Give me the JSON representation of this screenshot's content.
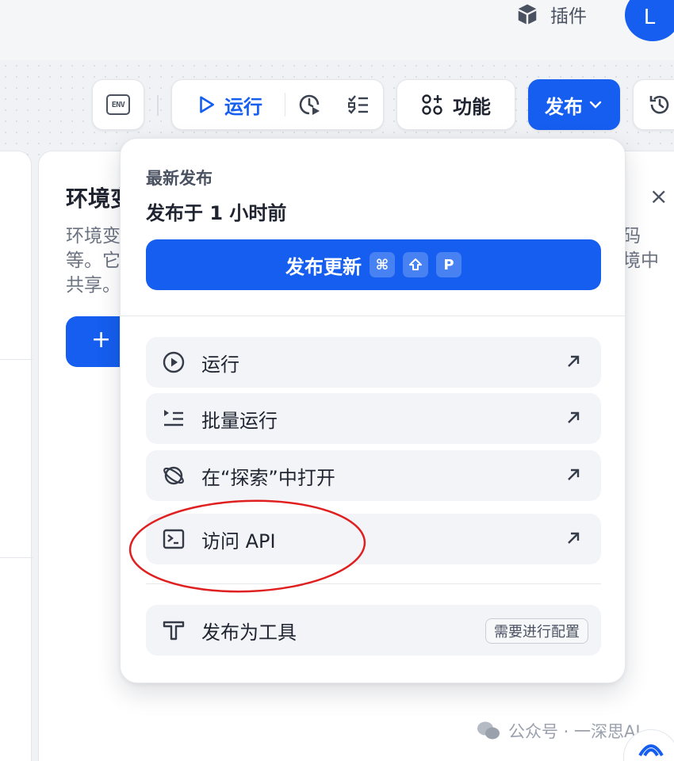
{
  "header": {
    "plugins_label": "插件",
    "avatar_initial": "L"
  },
  "toolbar": {
    "env_icon_text": "ENV",
    "run_label": "运行",
    "features_label": "功能",
    "publish_label": "发布"
  },
  "env_panel": {
    "title": "环境变",
    "description_left": "环境变\n等。它\n共享。",
    "description_right": "码\n境中",
    "close_glyph": "×",
    "add_glyph": "+"
  },
  "publish_menu": {
    "latest_label": "最新发布",
    "published_time": "发布于 1 小时前",
    "update_button_label": "发布更新",
    "shortcut_keys": [
      "⌘",
      "⇧",
      "P"
    ],
    "items": [
      {
        "label": "运行",
        "icon": "play-circle-icon"
      },
      {
        "label": "批量运行",
        "icon": "batch-list-icon"
      },
      {
        "label": "在“探索”中打开",
        "icon": "planet-icon"
      },
      {
        "label": "访问 API",
        "icon": "terminal-icon"
      }
    ],
    "tool_item": {
      "label": "发布为工具",
      "badge": "需要进行配置",
      "icon": "tool-icon"
    }
  },
  "watermark": "公众号 · 一深思AI",
  "colors": {
    "accent": "#155eef",
    "annotation": "#e02020",
    "menu_item_bg": "#f2f4f7"
  }
}
